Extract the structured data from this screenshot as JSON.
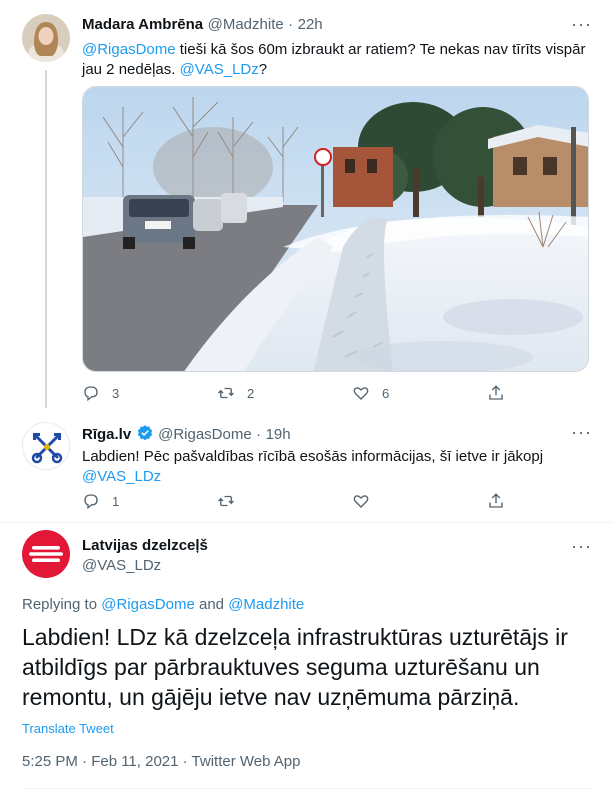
{
  "tweet1": {
    "name": "Madara Ambrēna",
    "handle": "@Madzhite",
    "dot": "·",
    "time": "22h",
    "mention1": "@RigasDome",
    "text1": " tieši kā šos 60m izbraukt ar ratiem? Te nekas nav tīrīts vispār jau 2 nedēļas. ",
    "mention2": "@VAS_LDz",
    "text2": "?",
    "image_icon": "snowy-sidewalk-photo",
    "replies": "3",
    "retweets": "2",
    "likes": "6"
  },
  "tweet2": {
    "name": "Rīga.lv",
    "handle": "@RigasDome",
    "dot": "·",
    "time": "19h",
    "text": "Labdien! Pēc pašvaldības rīcībā esošās informācijas, šī ietve ir jākopj ",
    "mention": "@VAS_LDz",
    "replies": "1"
  },
  "tweet3": {
    "name": "Latvijas dzelzceļš",
    "handle": "@VAS_LDz",
    "replying_prefix": "Replying to ",
    "replying_user1": "@RigasDome",
    "replying_and": " and ",
    "replying_user2": "@Madzhite",
    "text": "Labdien! LDz kā dzelzceļa infrastruktūras uzturētājs ir atbildīgs par pārbrauktuves seguma uzturēšanu un remontu, un gājēju ietve nav uzņēmuma pārziņā.",
    "translate": "Translate Tweet",
    "meta": "5:25 PM · Feb 11, 2021 · Twitter Web App"
  },
  "colors": {
    "link": "#1d9bf0",
    "muted": "#536471",
    "ldz_red": "#e31837"
  },
  "more_label": "···"
}
